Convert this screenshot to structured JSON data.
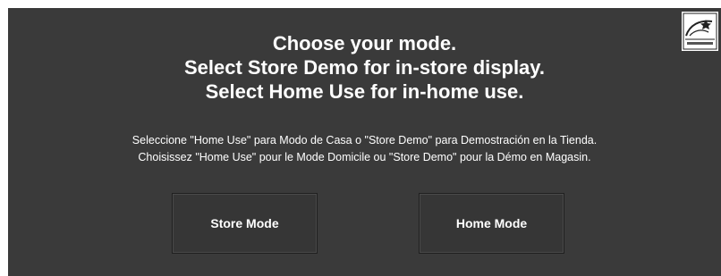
{
  "heading": {
    "line1": "Choose your mode.",
    "line2": "Select Store Demo for in-store display.",
    "line3": "Select Home Use for in-home use."
  },
  "subtext": {
    "spanish": "Seleccione \"Home Use\" para Modo de Casa o \"Store Demo\" para Demostración en la Tienda.",
    "french": "Choisissez \"Home Use\" pour le Mode Domicile ou \"Store Demo\" pour la Démo en Magasin."
  },
  "buttons": {
    "store_label": "Store Mode",
    "home_label": "Home Mode"
  },
  "logo": {
    "icon": "energy-star-icon",
    "text": "ENERGY STAR"
  },
  "colors": {
    "background": "#3a3a3a",
    "text": "#ffffff",
    "button": "#363636"
  }
}
